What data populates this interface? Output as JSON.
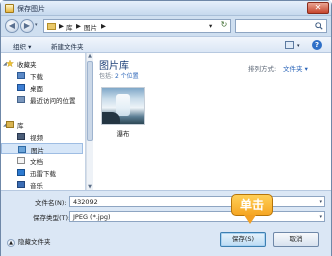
{
  "window": {
    "title": "保存图片",
    "close_label": "✕"
  },
  "address": {
    "sep1": "▶",
    "crumb1": "库",
    "sep2": "▶",
    "crumb2": "图片",
    "sep3": "▶",
    "dropdown": "▾",
    "refresh": "↻"
  },
  "toolbar": {
    "organize": "组织 ▾",
    "new_folder": "新建文件夹"
  },
  "sidebar": {
    "items": [
      {
        "label": "收藏夹",
        "icon": "star-icon"
      },
      {
        "label": "下载",
        "icon": "download-folder-icon"
      },
      {
        "label": "桌面",
        "icon": "desktop-icon"
      },
      {
        "label": "最近访问的位置",
        "icon": "recent-places-icon"
      },
      {
        "label": "库",
        "icon": "libraries-icon"
      },
      {
        "label": "视频",
        "icon": "video-icon"
      },
      {
        "label": "图片",
        "icon": "pictures-icon"
      },
      {
        "label": "文档",
        "icon": "documents-icon"
      },
      {
        "label": "迅雷下载",
        "icon": "thunder-download-icon"
      },
      {
        "label": "音乐",
        "icon": "music-icon"
      }
    ]
  },
  "content": {
    "library_title": "图片库",
    "library_sub_prefix": "包括:",
    "library_sub_link": "2 个位置",
    "arrange_label": "排列方式:",
    "arrange_value": "文件夹 ▾",
    "files": [
      {
        "name": "瀑布"
      }
    ]
  },
  "form": {
    "filename_label": "文件名(N):",
    "filename_value": "432092",
    "filetype_label": "保存类型(T):",
    "filetype_value": "JPEG (*.jpg)"
  },
  "bottom": {
    "hide_folders": "隐藏文件夹",
    "save_label": "保存(S)",
    "cancel_label": "取消"
  },
  "annotation": {
    "callout_text": "单击"
  },
  "colors": {
    "accent": "#2a64b8",
    "callout": "#f6a623"
  }
}
